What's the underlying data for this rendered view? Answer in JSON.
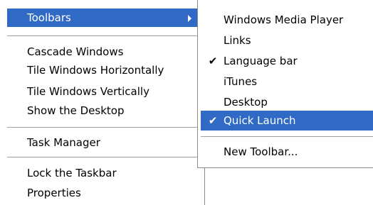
{
  "main_menu": {
    "items": [
      {
        "label": "Toolbars",
        "selected": true,
        "has_submenu": true
      },
      {
        "label": "Cascade Windows"
      },
      {
        "label": "Tile Windows Horizontally"
      },
      {
        "label": "Tile Windows Vertically"
      },
      {
        "label": "Show the Desktop"
      },
      {
        "label": "Task Manager"
      },
      {
        "label": "Lock the Taskbar"
      },
      {
        "label": "Properties"
      }
    ]
  },
  "toolbars_submenu": {
    "items": [
      {
        "label": "Windows Media Player",
        "checked": false
      },
      {
        "label": "Links",
        "checked": false
      },
      {
        "label": "Language bar",
        "checked": true
      },
      {
        "label": "iTunes",
        "checked": false
      },
      {
        "label": "Desktop",
        "checked": false
      },
      {
        "label": "Quick Launch",
        "checked": true,
        "selected": true
      },
      {
        "label": "New Toolbar...",
        "checked": false
      }
    ],
    "check_glyph": "✔"
  },
  "colors": {
    "selection": "#316ac5",
    "separator": "#a0a0a0"
  }
}
